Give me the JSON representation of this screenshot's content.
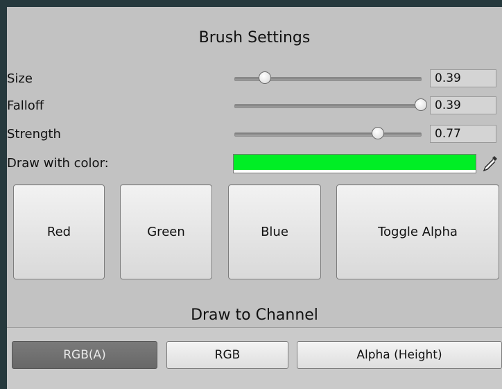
{
  "brush": {
    "title": "Brush Settings",
    "size": {
      "label": "Size",
      "value": "0.39",
      "level": 0.16
    },
    "falloff": {
      "label": "Falloff",
      "value": "0.39",
      "level": 1.0
    },
    "strength": {
      "label": "Strength",
      "value": "0.77",
      "level": 0.77
    },
    "color": {
      "label": "Draw with color:",
      "hex": "#00ee25"
    }
  },
  "channel_buttons": [
    {
      "label": "Red"
    },
    {
      "label": "Green"
    },
    {
      "label": "Blue"
    },
    {
      "label": "Toggle Alpha"
    }
  ],
  "draw_to_channel": {
    "title": "Draw to Channel",
    "tabs": [
      {
        "label": "RGB(A)",
        "active": true
      },
      {
        "label": "RGB",
        "active": false
      },
      {
        "label": "Alpha (Height)",
        "active": false
      }
    ]
  },
  "icons": {
    "eyedropper": "eyedropper-icon"
  }
}
